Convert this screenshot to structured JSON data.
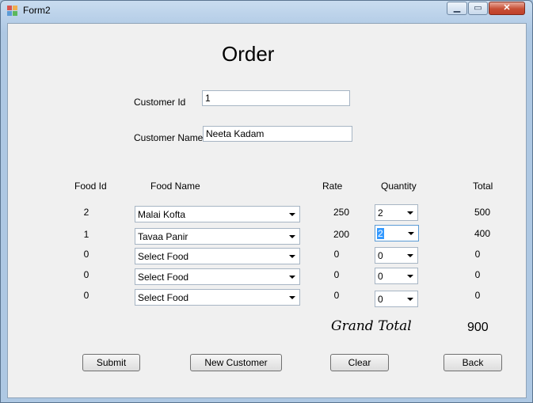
{
  "window": {
    "title": "Form2",
    "min_glyph": "▁",
    "max_glyph": "▭",
    "close_glyph": "✕"
  },
  "form": {
    "heading": "Order",
    "customer_id_label": "Customer Id",
    "customer_id_value": "1",
    "customer_name_label": "Customer Name",
    "customer_name_value": "Neeta Kadam"
  },
  "columns": {
    "food_id": "Food Id",
    "food_name": "Food Name",
    "rate": "Rate",
    "quantity": "Quantity",
    "total": "Total"
  },
  "rows": [
    {
      "food_id": "2",
      "food_name": "Malai Kofta",
      "rate": "250",
      "quantity": "2",
      "total": "500"
    },
    {
      "food_id": "1",
      "food_name": "Tavaa Panir",
      "rate": "200",
      "quantity": "2",
      "total": "400"
    },
    {
      "food_id": "0",
      "food_name": "Select Food",
      "rate": "0",
      "quantity": "0",
      "total": "0"
    },
    {
      "food_id": "0",
      "food_name": "Select Food",
      "rate": "0",
      "quantity": "0",
      "total": "0"
    },
    {
      "food_id": "0",
      "food_name": "Select Food",
      "rate": "0",
      "quantity": "0",
      "total": "0"
    }
  ],
  "grand_total": {
    "label": "Grand Total",
    "value": "900"
  },
  "buttons": {
    "submit": "Submit",
    "new_customer": "New Customer",
    "clear": "Clear",
    "back": "Back"
  },
  "colors": {
    "selection": "#3399ff",
    "close_button": "#c74f35"
  }
}
